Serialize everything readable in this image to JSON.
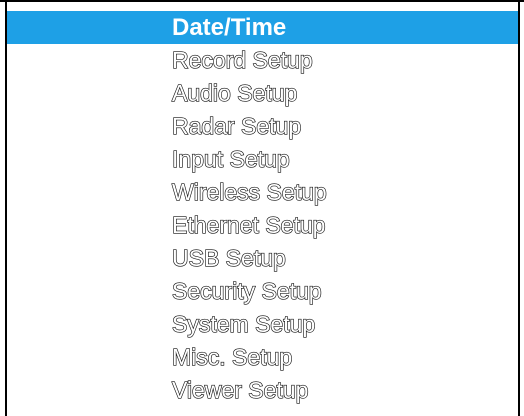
{
  "menu": {
    "selected_color": "#1ea0e6",
    "items": [
      {
        "label": "Date/Time",
        "selected": true
      },
      {
        "label": "Record Setup"
      },
      {
        "label": "Audio Setup"
      },
      {
        "label": "Radar Setup"
      },
      {
        "label": "Input Setup"
      },
      {
        "label": "Wireless Setup"
      },
      {
        "label": "Ethernet Setup"
      },
      {
        "label": "USB Setup"
      },
      {
        "label": "Security Setup"
      },
      {
        "label": "System Setup"
      },
      {
        "label": "Misc. Setup"
      },
      {
        "label": "Viewer Setup"
      }
    ]
  }
}
